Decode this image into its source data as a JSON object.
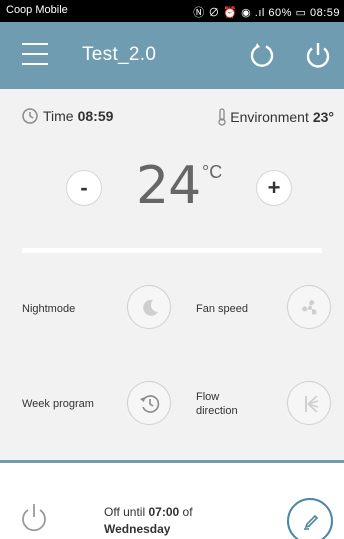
{
  "status_bar": {
    "carrier": "Coop Mobile",
    "icons": "Ⓝ ∅ ⏰ ◉ .ıl",
    "battery_text": "60%",
    "time": "08:59"
  },
  "appbar": {
    "title": "Test_2.0",
    "color": "#6f9cb1"
  },
  "info": {
    "time_label": "Time",
    "time_value": "08:59",
    "environment_label": "Environment",
    "environment_value": "23°"
  },
  "thermostat": {
    "minus_label": "-",
    "temperature": "24",
    "unit": "°C",
    "plus_label": "+"
  },
  "features": {
    "nightmode": "Nightmode",
    "fan_speed": "Fan speed",
    "week_program": "Week program",
    "flow_direction_1": "Flow",
    "flow_direction_2": "direction"
  },
  "footer": {
    "off_text_1": "Off until",
    "off_time": "07:00",
    "off_text_2": "of",
    "off_day": "Wednesday"
  },
  "icons": {
    "menu": "hamburger-menu-icon",
    "refresh": "refresh-icon",
    "power": "power-icon",
    "clock": "clock-icon",
    "thermometer": "thermometer-icon",
    "moon": "moon-icon",
    "fan": "fan-icon",
    "history": "week-program-icon",
    "flow": "flow-direction-icon",
    "edit": "pencil-icon"
  }
}
